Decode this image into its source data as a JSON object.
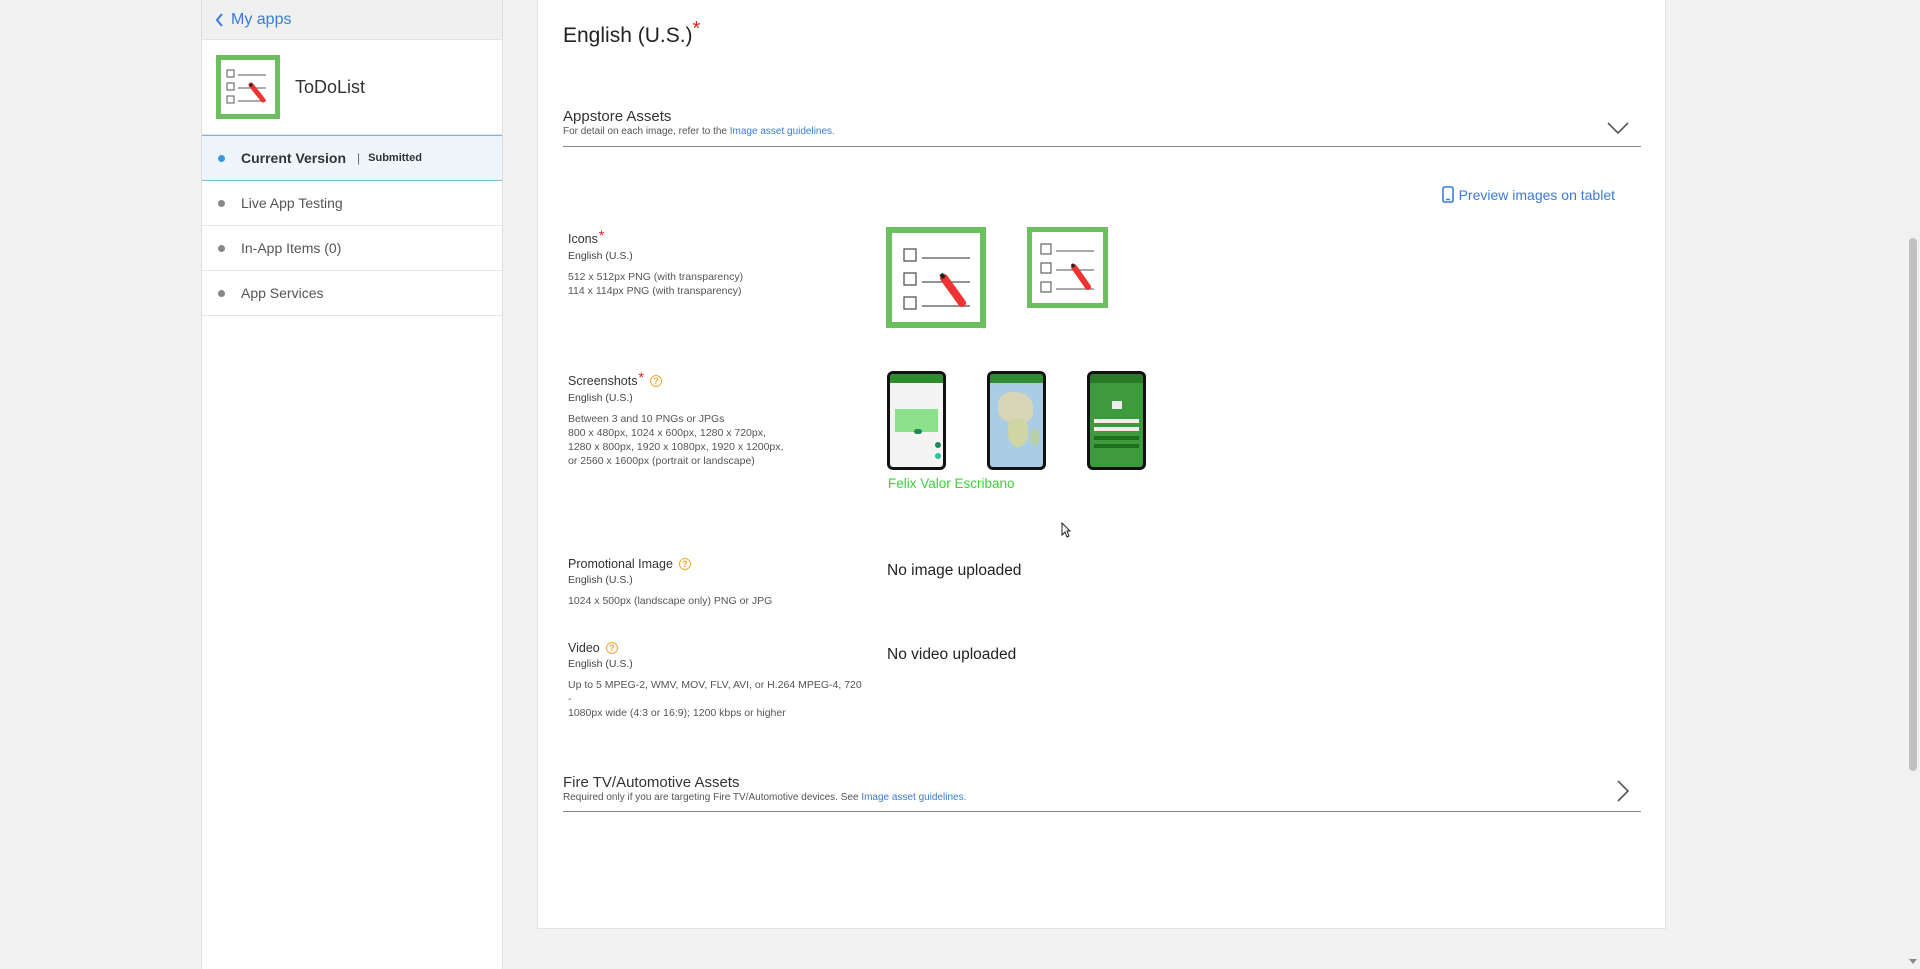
{
  "sidebar": {
    "back_label": "My apps",
    "app_name": "ToDoList",
    "items": [
      {
        "label": "Current Version",
        "separator": "|",
        "status": "Submitted"
      },
      {
        "label": "Live App Testing"
      },
      {
        "label": "In-App Items (0)"
      },
      {
        "label": "App Services"
      }
    ]
  },
  "main": {
    "language_title": "English (U.S.)",
    "required_mark": "*",
    "appstore_assets": {
      "title": "Appstore Assets",
      "subtitle_prefix": "For detail on each image, refer to the ",
      "subtitle_link": "Image asset guidelines."
    },
    "preview_link": "Preview images on tablet",
    "icons": {
      "name": "Icons",
      "lang": "English (U.S.)",
      "spec": "512 x 512px PNG (with transparency)\n114 x 114px PNG (with transparency)"
    },
    "screenshots": {
      "name": "Screenshots",
      "lang": "English (U.S.)",
      "spec": "Between 3 and 10 PNGs or JPGs\n800 x 480px, 1024 x 600px, 1280 x 720px,\n1280 x 800px, 1920 x 1080px, 1920 x 1200px,\nor 2560 x 1600px (portrait or landscape)",
      "author": "Felix Valor Escribano"
    },
    "promo": {
      "name": "Promotional Image",
      "lang": "English (U.S.)",
      "spec": "1024 x 500px (landscape only) PNG or JPG",
      "empty": "No image uploaded"
    },
    "video": {
      "name": "Video",
      "lang": "English (U.S.)",
      "spec": "Up to 5 MPEG-2, WMV, MOV, FLV, AVI, or H.264 MPEG-4, 720 -\n1080px wide (4:3 or 16:9); 1200 kbps or higher",
      "empty": "No video uploaded"
    },
    "fire_tv": {
      "title": "Fire TV/Automotive Assets",
      "subtitle_prefix": "Required only if you are targeting Fire TV/Automotive devices. See ",
      "subtitle_link": "Image asset guidelines."
    }
  },
  "colors": {
    "accent": "#3a7bd5",
    "icon_green": "#6cbf5e",
    "required": "#e02020",
    "help": "#f0a830",
    "author": "#3ad13a"
  }
}
